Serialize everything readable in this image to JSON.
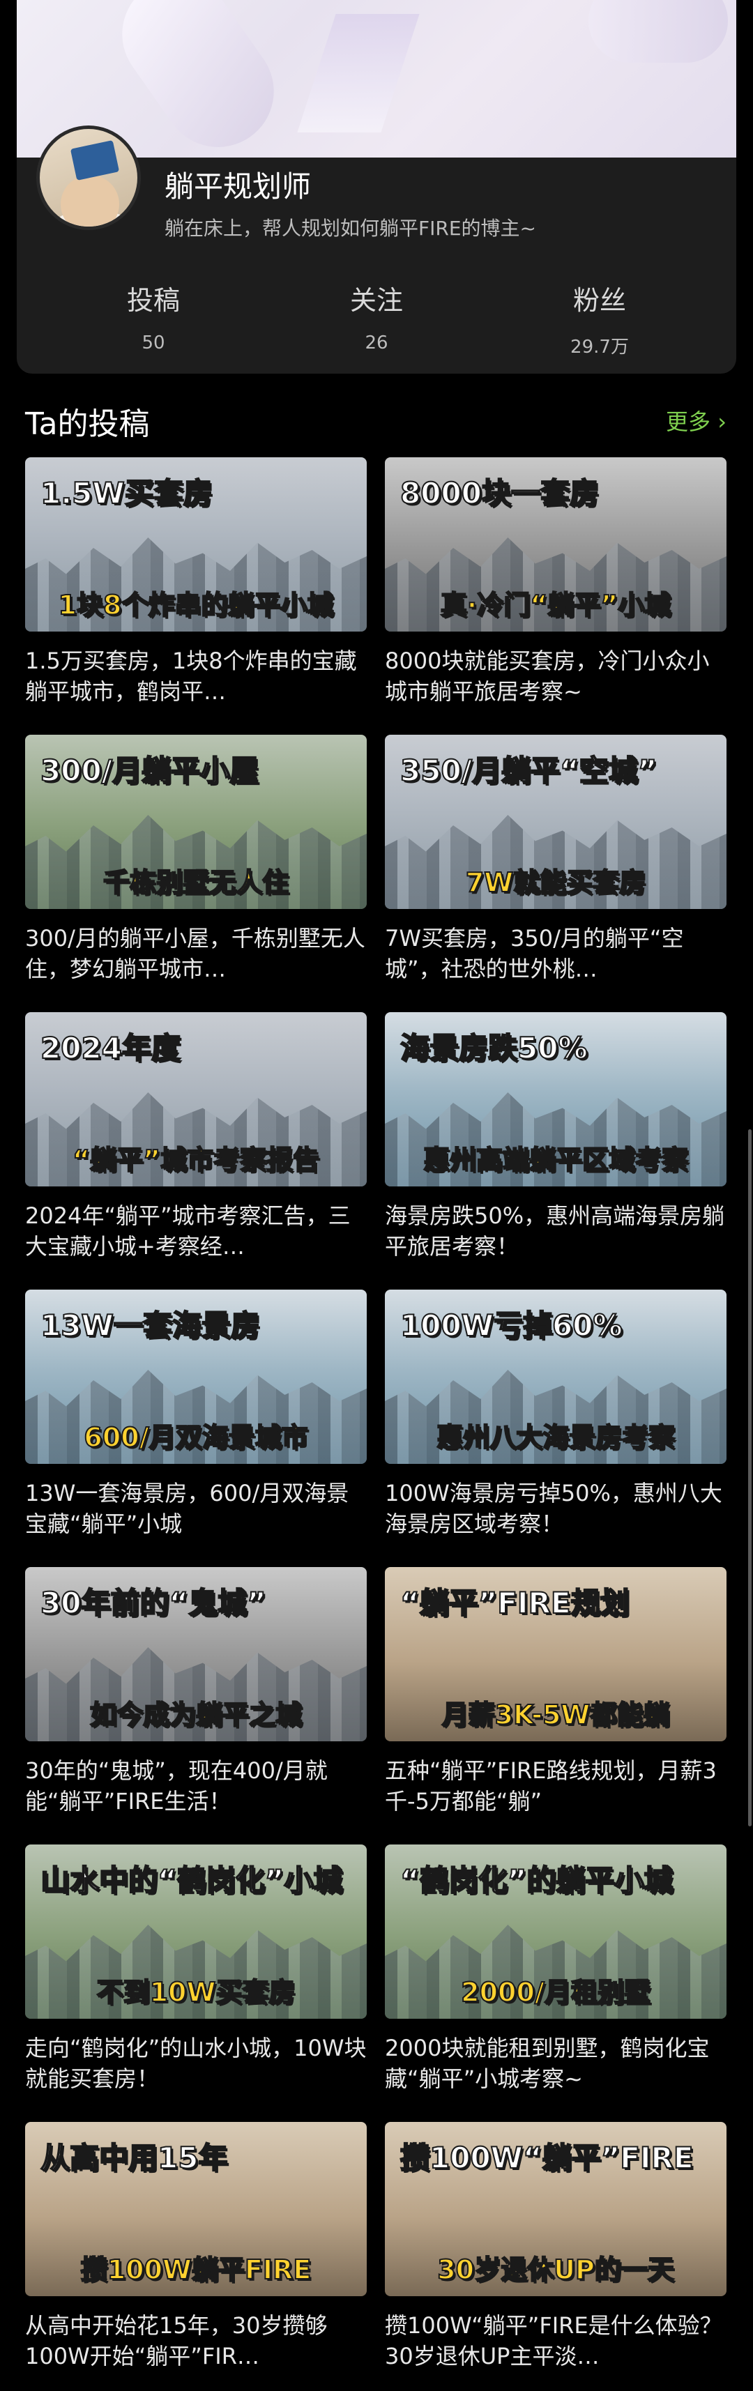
{
  "profile": {
    "name": "躺平规划师",
    "bio": "躺在床上，帮人规划如何躺平FIRE的博主~",
    "stats": [
      {
        "label": "投稿",
        "value": "50"
      },
      {
        "label": "关注",
        "value": "26"
      },
      {
        "label": "粉丝",
        "value": "29.7万"
      }
    ]
  },
  "section": {
    "title": "Ta的投稿",
    "more": "更多 ›"
  },
  "videos": [
    {
      "top": "1.5W买套房",
      "bottom": "1块8个炸串的躺平小城",
      "caption": "1.5万买套房，1块8个炸串的宝藏躺平城市，鹤岗平…"
    },
    {
      "top": "8000块一套房",
      "bottom": "真·冷门“躺平”小城",
      "caption": "8000块就能买套房，冷门小众小城市躺平旅居考察~"
    },
    {
      "top": "300/月躺平小屋",
      "bottom": "千栋别墅无人住",
      "caption": "300/月的躺平小屋，千栋别墅无人住，梦幻躺平城市…"
    },
    {
      "top": "350/月躺平“空城”",
      "bottom": "7W就能买套房",
      "caption": "7W买套房，350/月的躺平“空城”，社恐的世外桃…"
    },
    {
      "top": "2024年度",
      "bottom": "“躺平”城市考察报告",
      "caption": "2024年“躺平”城市考察汇告，三大宝藏小城+考察经…"
    },
    {
      "top": "海景房跌50%",
      "bottom": "惠州高端躺平区域考察",
      "caption": "海景房跌50%，惠州高端海景房躺平旅居考察！"
    },
    {
      "top": "13W一套海景房",
      "bottom": "600/月双海景城市",
      "caption": "13W一套海景房，600/月双海景宝藏“躺平”小城"
    },
    {
      "top": "100W亏掉60%",
      "bottom": "惠州八大海景房考察",
      "caption": "100W海景房亏掉50%，惠州八大海景房区域考察！"
    },
    {
      "top": "30年前的“鬼城”",
      "bottom": "如今成为躺平之城",
      "caption": "30年的“鬼城”，现在400/月就能“躺平”FIRE生活！"
    },
    {
      "top": "“躺平”FIRE规划",
      "bottom": "月薪3K-5W都能躺",
      "caption": "五种“躺平”FIRE路线规划，月薪3千-5万都能“躺”"
    },
    {
      "top": "山水中的“鹤岗化”小城",
      "bottom": "不到10W买套房",
      "caption": "走向“鹤岗化”的山水小城，10W块就能买套房！"
    },
    {
      "top": "“鹤岗化”的躺平小城",
      "bottom": "2000/月租别墅",
      "caption": "2000块就能租到别墅，鹤岗化宝藏“躺平”小城考察~"
    },
    {
      "top": "从高中用15年",
      "bottom": "攒100W躺平FIRE",
      "caption": "从高中开始花15年，30岁攒够100W开始“躺平”FIR…"
    },
    {
      "top": "攒100W“躺平”FIRE",
      "bottom": "30岁退休UP的一天",
      "caption": "攒100W“躺平”FIRE是什么体验？30岁退休UP主平淡…"
    }
  ]
}
